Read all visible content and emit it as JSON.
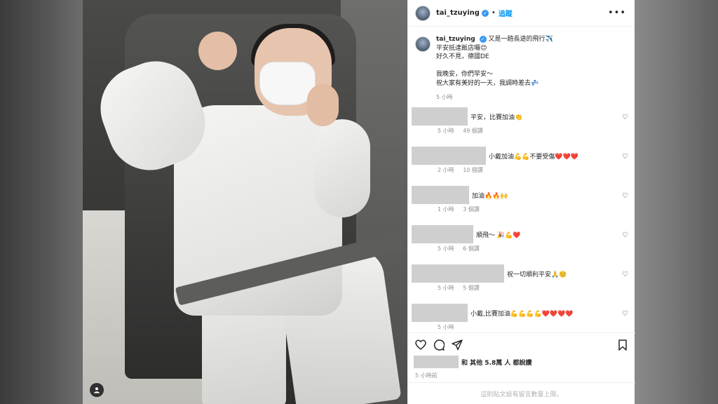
{
  "header": {
    "username": "tai_tzuying",
    "separator": "•",
    "follow_label": "追蹤",
    "more_label": "•••"
  },
  "caption": {
    "username": "tai_tzuying",
    "lines": [
      "又是一趟長途的飛行✈️",
      "平安抵達飯店囉😊",
      "好久不見，德國DE",
      "",
      "我晚安，你們早安～",
      "祝大家有美好的一天，我調時差去💤"
    ],
    "time": "5 小時"
  },
  "comments": [
    {
      "text": "平安，比賽加油👏",
      "time": "5 小時",
      "likes": "49 個讚"
    },
    {
      "text": "小戴加油💪💪不要受傷❤️❤️❤️",
      "time": "2 小時",
      "likes": "10 個讚"
    },
    {
      "text": "加油🔥🔥🙌",
      "time": "1 小時",
      "likes": "3 個讚"
    },
    {
      "text": "順飛～ 🎉💪❤️",
      "time": "5 小時",
      "likes": "6 個讚"
    },
    {
      "text": "祝一切順利平安🙏☺️",
      "time": "5 小時",
      "likes": "5 個讚"
    },
    {
      "text": "小戴,比賽加油💪💪💪💪❤️❤️❤️❤️",
      "time": "5 小時",
      "likes": ""
    }
  ],
  "actions": {
    "like_icon": "heart-icon",
    "comment_icon": "comment-icon",
    "share_icon": "share-icon",
    "save_icon": "bookmark-icon"
  },
  "likes_text": "和 其他 5.8萬 人 都說讚",
  "post_time": "5 小時前",
  "footer_text": "這則貼文設有留言數量上限。"
}
